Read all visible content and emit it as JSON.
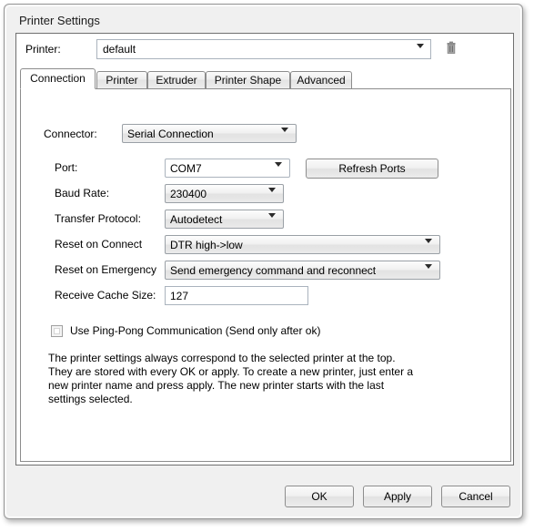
{
  "window": {
    "title": "Printer Settings"
  },
  "printer_row": {
    "label": "Printer:",
    "value": "default",
    "delete_icon": "trash-icon"
  },
  "tabs": [
    {
      "label": "Connection",
      "active": true
    },
    {
      "label": "Printer",
      "active": false
    },
    {
      "label": "Extruder",
      "active": false
    },
    {
      "label": "Printer Shape",
      "active": false
    },
    {
      "label": "Advanced",
      "active": false
    }
  ],
  "connection": {
    "connector": {
      "label": "Connector:",
      "value": "Serial Connection"
    },
    "port": {
      "label": "Port:",
      "value": "COM7"
    },
    "refresh_ports": {
      "label": "Refresh Ports"
    },
    "baud_rate": {
      "label": "Baud Rate:",
      "value": "230400"
    },
    "transfer_protocol": {
      "label": "Transfer Protocol:",
      "value": "Autodetect"
    },
    "reset_on_connect": {
      "label": "Reset on Connect",
      "value": "DTR high->low"
    },
    "reset_on_emergency": {
      "label": "Reset on Emergency",
      "value": "Send emergency command and reconnect"
    },
    "receive_cache_size": {
      "label": "Receive Cache Size:",
      "value": "127"
    },
    "ping_pong": {
      "label": "Use Ping-Pong Communication (Send only after ok)",
      "checked": false
    },
    "description": "The printer settings always correspond to the selected printer at the top. They are stored with every OK or apply. To create a new printer, just enter a new printer name and press apply. The new printer starts with the last settings selected."
  },
  "footer": {
    "ok": "OK",
    "apply": "Apply",
    "cancel": "Cancel"
  },
  "colors": {
    "window_bg": "#f0f0f0",
    "panel_bg": "#ffffff",
    "border": "#707070",
    "text": "#000000"
  }
}
